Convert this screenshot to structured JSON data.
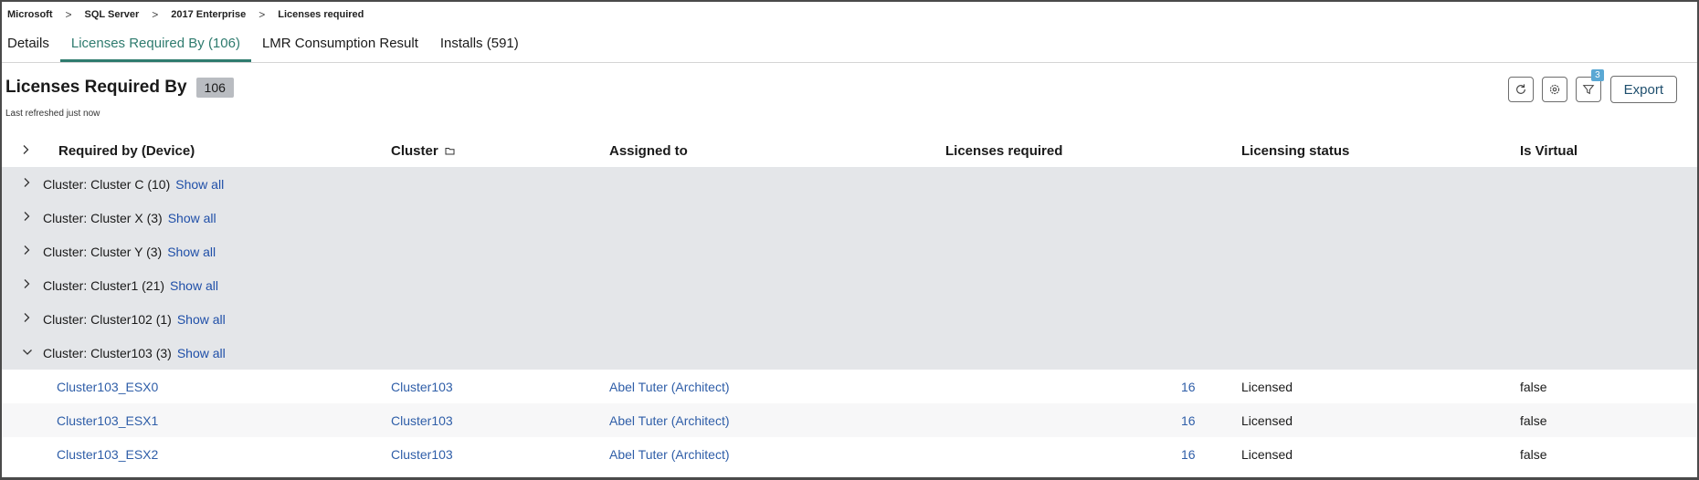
{
  "breadcrumb": [
    "Microsoft",
    "SQL Server",
    "2017 Enterprise",
    "Licenses required"
  ],
  "tabs": [
    {
      "label": "Details",
      "active": false
    },
    {
      "label": "Licenses Required By (106)",
      "active": true
    },
    {
      "label": "LMR Consumption Result",
      "active": false
    },
    {
      "label": "Installs (591)",
      "active": false
    }
  ],
  "header": {
    "title": "Licenses Required By",
    "count": "106",
    "refreshed": "Last refreshed just now",
    "filter_count": "3",
    "export_label": "Export"
  },
  "columns": {
    "device": "Required by (Device)",
    "cluster": "Cluster",
    "assigned": "Assigned to",
    "licenses": "Licenses required",
    "status": "Licensing status",
    "virtual": "Is Virtual"
  },
  "show_all_label": "Show all",
  "groups": [
    {
      "label": "Cluster: Cluster C (10)",
      "expanded": false
    },
    {
      "label": "Cluster: Cluster X (3)",
      "expanded": false
    },
    {
      "label": "Cluster: Cluster Y (3)",
      "expanded": false
    },
    {
      "label": "Cluster: Cluster1 (21)",
      "expanded": false
    },
    {
      "label": "Cluster: Cluster102 (1)",
      "expanded": false
    },
    {
      "label": "Cluster: Cluster103 (3)",
      "expanded": true
    }
  ],
  "rows": [
    {
      "device": "Cluster103_ESX0",
      "cluster": "Cluster103",
      "assigned": "Abel Tuter (Architect)",
      "licenses": "16",
      "status": "Licensed",
      "virtual": "false"
    },
    {
      "device": "Cluster103_ESX1",
      "cluster": "Cluster103",
      "assigned": "Abel Tuter (Architect)",
      "licenses": "16",
      "status": "Licensed",
      "virtual": "false"
    },
    {
      "device": "Cluster103_ESX2",
      "cluster": "Cluster103",
      "assigned": "Abel Tuter (Architect)",
      "licenses": "16",
      "status": "Licensed",
      "virtual": "false"
    }
  ],
  "colors": {
    "accent": "#2e7b6e",
    "link": "#2f5ea8",
    "group_bg": "#e4e6e9"
  }
}
